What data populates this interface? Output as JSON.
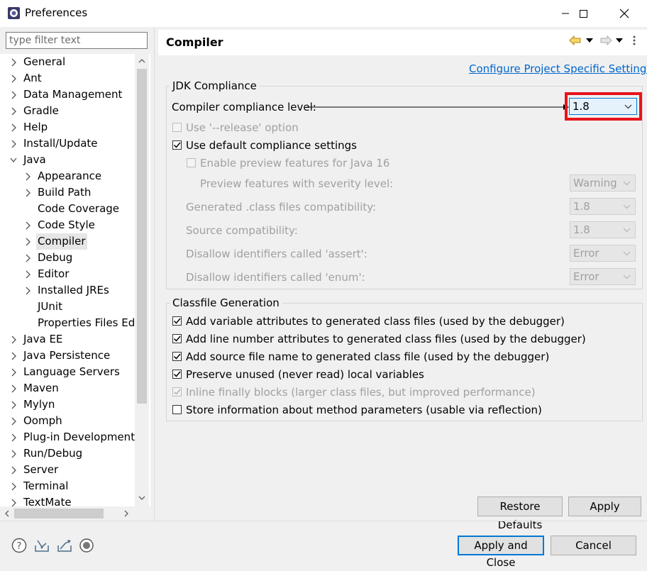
{
  "window": {
    "title": "Preferences",
    "minimize_glyph": "—",
    "maximize_glyph": "☐",
    "close_glyph": "✕"
  },
  "filter": {
    "placeholder": "type filter text"
  },
  "tree": {
    "items": [
      {
        "label": "General",
        "twisty": "collapsed",
        "indent": 0
      },
      {
        "label": "Ant",
        "twisty": "collapsed",
        "indent": 0
      },
      {
        "label": "Data Management",
        "twisty": "collapsed",
        "indent": 0
      },
      {
        "label": "Gradle",
        "twisty": "collapsed",
        "indent": 0
      },
      {
        "label": "Help",
        "twisty": "collapsed",
        "indent": 0
      },
      {
        "label": "Install/Update",
        "twisty": "collapsed",
        "indent": 0
      },
      {
        "label": "Java",
        "twisty": "expanded",
        "indent": 0
      },
      {
        "label": "Appearance",
        "twisty": "collapsed",
        "indent": 1
      },
      {
        "label": "Build Path",
        "twisty": "collapsed",
        "indent": 1
      },
      {
        "label": "Code Coverage",
        "twisty": "none",
        "indent": 1
      },
      {
        "label": "Code Style",
        "twisty": "collapsed",
        "indent": 1
      },
      {
        "label": "Compiler",
        "twisty": "collapsed",
        "indent": 1,
        "selected": true
      },
      {
        "label": "Debug",
        "twisty": "collapsed",
        "indent": 1
      },
      {
        "label": "Editor",
        "twisty": "collapsed",
        "indent": 1
      },
      {
        "label": "Installed JREs",
        "twisty": "collapsed",
        "indent": 1
      },
      {
        "label": "JUnit",
        "twisty": "none",
        "indent": 1
      },
      {
        "label": "Properties Files Edito",
        "twisty": "none",
        "indent": 1
      },
      {
        "label": "Java EE",
        "twisty": "collapsed",
        "indent": 0
      },
      {
        "label": "Java Persistence",
        "twisty": "collapsed",
        "indent": 0
      },
      {
        "label": "Language Servers",
        "twisty": "collapsed",
        "indent": 0
      },
      {
        "label": "Maven",
        "twisty": "collapsed",
        "indent": 0
      },
      {
        "label": "Mylyn",
        "twisty": "collapsed",
        "indent": 0
      },
      {
        "label": "Oomph",
        "twisty": "collapsed",
        "indent": 0
      },
      {
        "label": "Plug-in Development",
        "twisty": "collapsed",
        "indent": 0
      },
      {
        "label": "Run/Debug",
        "twisty": "collapsed",
        "indent": 0
      },
      {
        "label": "Server",
        "twisty": "collapsed",
        "indent": 0
      },
      {
        "label": "Terminal",
        "twisty": "collapsed",
        "indent": 0
      },
      {
        "label": "TextMate",
        "twisty": "collapsed",
        "indent": 0
      }
    ]
  },
  "page": {
    "title": "Compiler",
    "configure_link": "Configure Project Specific Settings...",
    "nav_icons": [
      "back-arrow-icon",
      "forward-arrow-icon",
      "view-menu-icon"
    ]
  },
  "jdk": {
    "group_title": "JDK Compliance",
    "compliance_label": "Compiler compliance level:",
    "compliance_value": "1.8",
    "release_option": {
      "label": "Use '--release' option",
      "checked": false,
      "enabled": false
    },
    "use_default": {
      "label": "Use default compliance settings",
      "checked": true,
      "enabled": true
    },
    "enable_preview": {
      "label": "Enable preview features for Java 16",
      "checked": false,
      "enabled": false
    },
    "rows": [
      {
        "label": "Preview features with severity level:",
        "value": "Warning"
      },
      {
        "label": "Generated .class files compatibility:",
        "value": "1.8"
      },
      {
        "label": "Source compatibility:",
        "value": "1.8"
      },
      {
        "label": "Disallow identifiers called 'assert':",
        "value": "Error"
      },
      {
        "label": "Disallow identifiers called 'enum':",
        "value": "Error"
      }
    ]
  },
  "classfile": {
    "group_title": "Classfile Generation",
    "options": [
      {
        "label": "Add variable attributes to generated class files (used by the debugger)",
        "checked": true,
        "enabled": true
      },
      {
        "label": "Add line number attributes to generated class files (used by the debugger)",
        "checked": true,
        "enabled": true
      },
      {
        "label": "Add source file name to generated class file (used by the debugger)",
        "checked": true,
        "enabled": true
      },
      {
        "label": "Preserve unused (never read) local variables",
        "checked": true,
        "enabled": true
      },
      {
        "label": "Inline finally blocks (larger class files, but improved performance)",
        "checked": true,
        "enabled": false
      },
      {
        "label": "Store information about method parameters (usable via reflection)",
        "checked": false,
        "enabled": true
      }
    ]
  },
  "buttons": {
    "restore_defaults": "Restore Defaults",
    "apply": "Apply",
    "apply_and_close": "Apply and Close",
    "cancel": "Cancel"
  },
  "footer_icons": [
    "help-icon",
    "import-icon",
    "export-icon",
    "record-icon"
  ],
  "colors": {
    "link": "#0066cc",
    "highlight": "#e8141c",
    "default_button_border": "#0078d7",
    "disabled_text": "#a0a0a0"
  }
}
